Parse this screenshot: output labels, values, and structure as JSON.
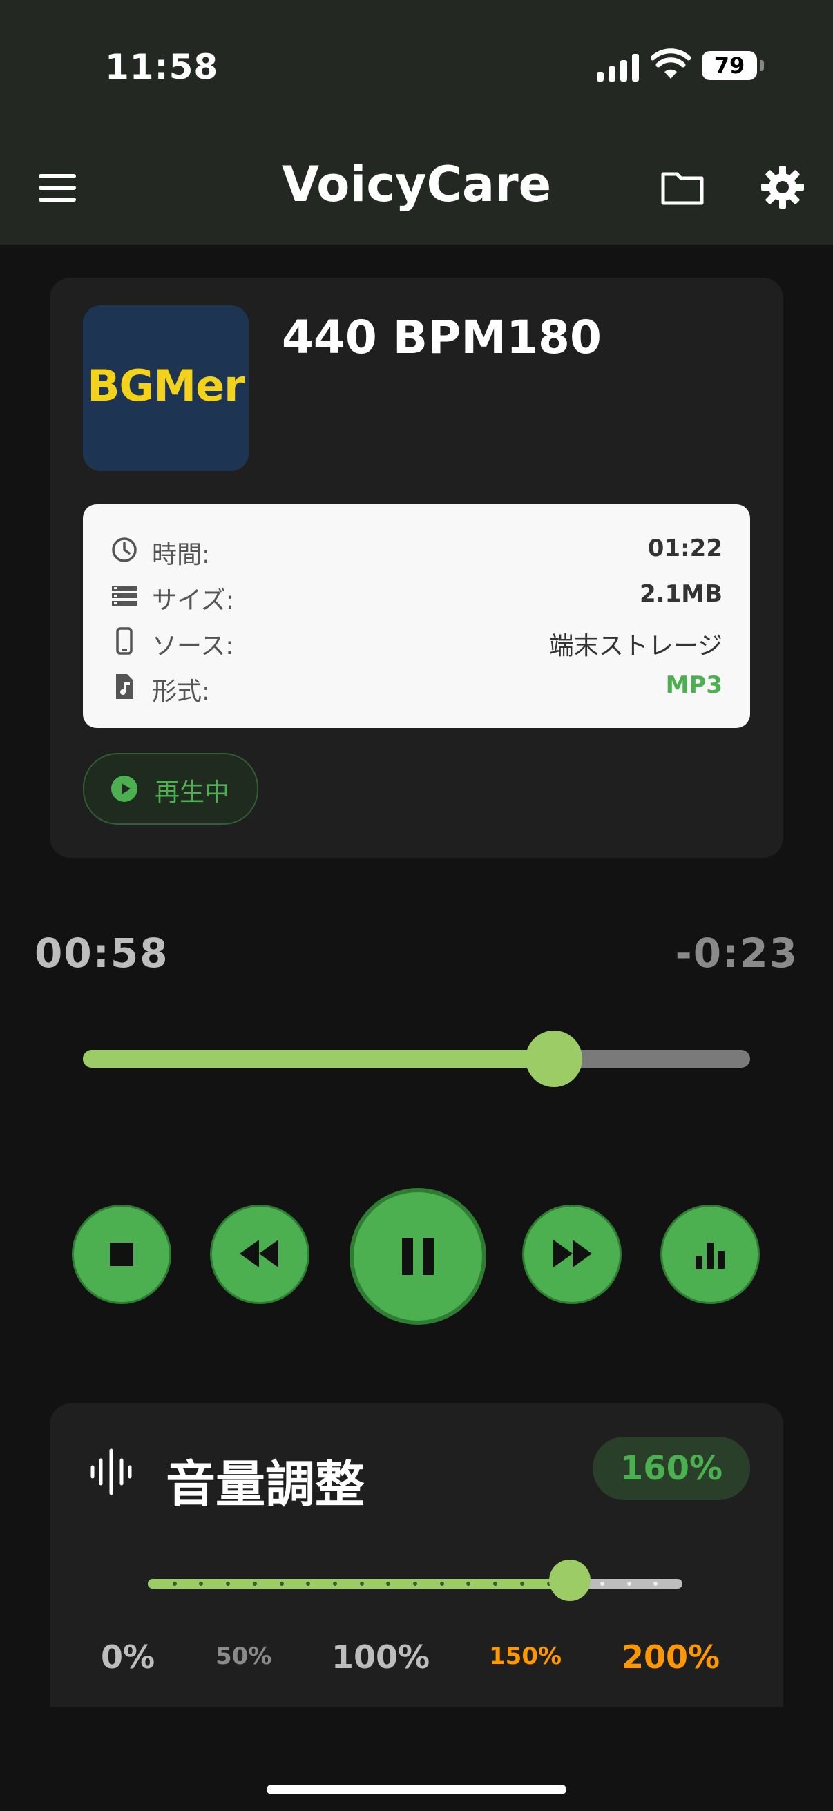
{
  "status": {
    "time": "11:58",
    "battery": "79"
  },
  "app": {
    "title": "VoicyCare"
  },
  "track": {
    "cover_text": "BGMer",
    "title": "440 BPM180",
    "info": {
      "duration_label": "時間:",
      "duration_value": "01:22",
      "size_label": "サイズ:",
      "size_value": "2.1MB",
      "source_label": "ソース:",
      "source_value": "端末ストレージ",
      "format_label": "形式:",
      "format_value": "MP3"
    },
    "status_label": "再生中"
  },
  "player": {
    "elapsed": "00:58",
    "remaining": "-0:23",
    "progress": 0.706
  },
  "volume": {
    "title": "音量調整",
    "value_label": "160%",
    "level": 0.79,
    "scale": [
      "0%",
      "50%",
      "100%",
      "150%",
      "200%"
    ]
  },
  "colors": {
    "accent": "#4caf50",
    "light_green": "#9ccc65",
    "orange": "#ff9800",
    "cover_bg": "#1d3553",
    "cover_text": "#f2d21a"
  },
  "icons": [
    "menu-icon",
    "folder-icon",
    "gear-icon",
    "clock-icon",
    "storage-icon",
    "phone-icon",
    "music-file-icon",
    "play-icon",
    "stop-icon",
    "rewind-icon",
    "pause-icon",
    "fast-forward-icon",
    "equalizer-icon",
    "waveform-icon"
  ]
}
